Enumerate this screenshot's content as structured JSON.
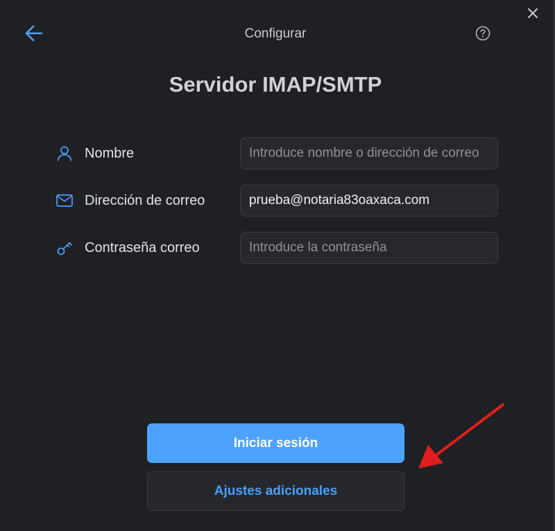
{
  "header": {
    "title": "Configurar",
    "back_icon": "arrow-left-icon",
    "help_icon": "question-circle-icon",
    "close_icon": "close-icon"
  },
  "page_title": "Servidor IMAP/SMTP",
  "form": {
    "name": {
      "label": "Nombre",
      "icon": "user-icon",
      "value": "",
      "placeholder": "Introduce nombre o dirección de correo"
    },
    "email": {
      "label": "Dirección de correo",
      "icon": "envelope-icon",
      "value": "prueba@notaria83oaxaca.com",
      "placeholder": ""
    },
    "password": {
      "label": "Contraseña correo",
      "icon": "key-icon",
      "value": "",
      "placeholder": "Introduce la contraseña"
    }
  },
  "buttons": {
    "login": "Iniciar sesión",
    "advanced": "Ajustes adicionales"
  },
  "colors": {
    "background": "#1f2024",
    "accent": "#4da3fb",
    "annotation_arrow": "#e01e1e"
  }
}
